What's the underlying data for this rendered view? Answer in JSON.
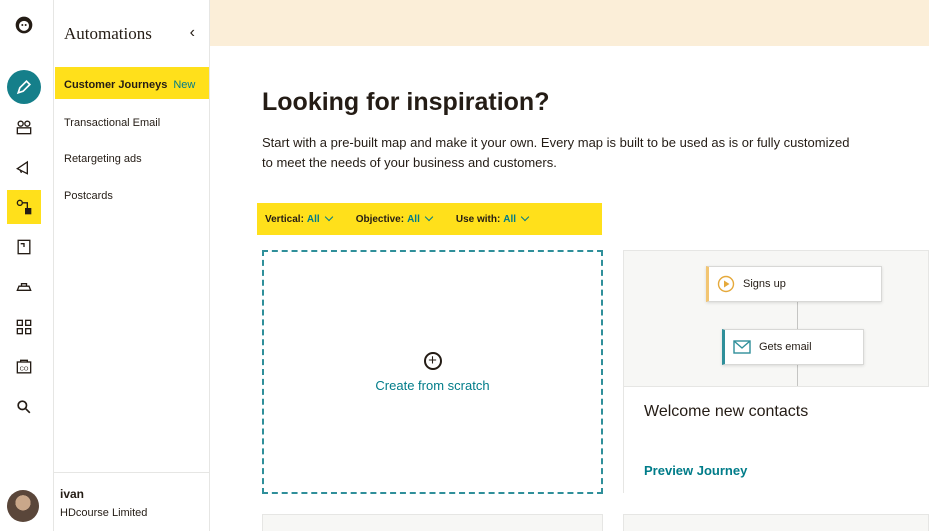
{
  "rail": {
    "icons": [
      "mailchimp-freddie-logo",
      "pencil-create-icon",
      "audience-icon",
      "campaigns-megaphone-icon",
      "automations-icon",
      "landing-page-icon",
      "integrations-icon",
      "apps-grid-icon",
      "content-studio-icon",
      "search-icon"
    ]
  },
  "sidebar": {
    "title": "Automations",
    "items": [
      {
        "label": "Customer Journeys",
        "badge": "New"
      },
      {
        "label": "Transactional Email"
      },
      {
        "label": "Retargeting ads"
      },
      {
        "label": "Postcards"
      }
    ],
    "user": {
      "name": "ivan",
      "org": "HDcourse Limited"
    }
  },
  "main": {
    "title": "Looking for inspiration?",
    "description": "Start with a pre-built map and make it your own. Every map is built to be used as is or fully customized to meet the needs of your business and customers.",
    "filters": [
      {
        "label": "Vertical:",
        "value": "All"
      },
      {
        "label": "Objective:",
        "value": "All"
      },
      {
        "label": "Use with:",
        "value": "All"
      }
    ],
    "scratch_label": "Create from scratch",
    "card": {
      "node1": "Signs up",
      "node2": "Gets email",
      "title": "Welcome new contacts",
      "link": "Preview Journey"
    }
  },
  "colors": {
    "highlight": "#ffe01b",
    "teal": "#007c89",
    "banner": "#fbeed8"
  }
}
